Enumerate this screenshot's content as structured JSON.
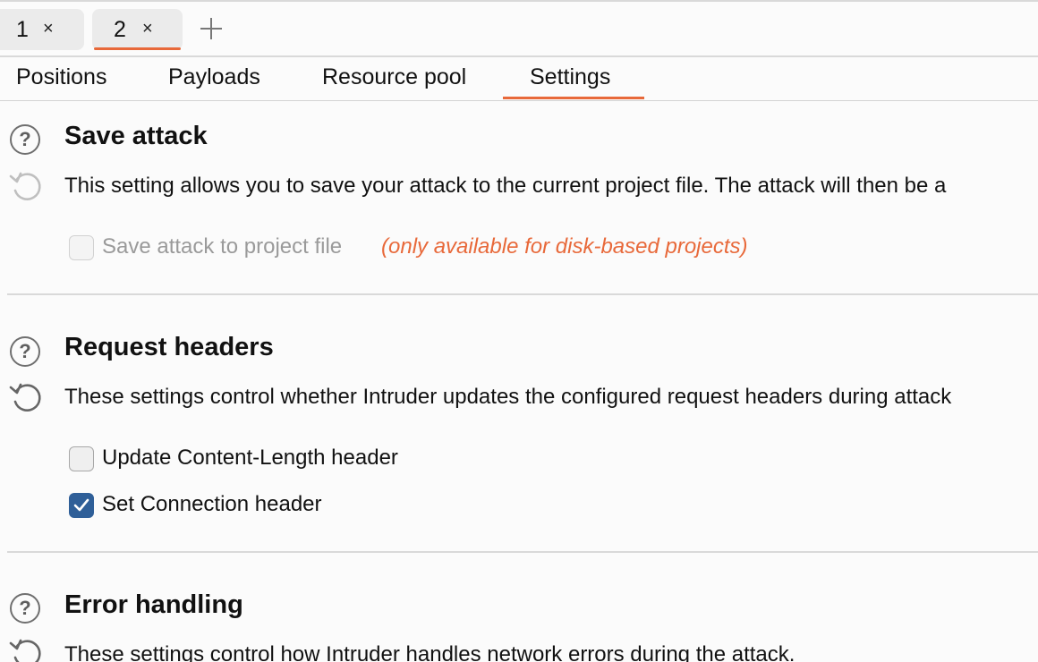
{
  "attack_tabs": [
    {
      "label": "1",
      "close": "×",
      "selected": false
    },
    {
      "label": "2",
      "close": "×",
      "selected": true
    }
  ],
  "sub_tabs": [
    {
      "label": "Positions"
    },
    {
      "label": "Payloads"
    },
    {
      "label": "Resource pool"
    },
    {
      "label": "Settings",
      "selected": true
    }
  ],
  "accent_color": "#e8693a",
  "checkbox_color": "#2f5f98",
  "sections": {
    "save_attack": {
      "title": "Save attack",
      "description": "This setting allows you to save your attack to the current project file. The attack will then be a",
      "option_label": "Save attack to project file",
      "option_checked": false,
      "option_disabled": true,
      "note": "(only available for disk-based projects)"
    },
    "request_headers": {
      "title": "Request headers",
      "description": "These settings control whether Intruder updates the configured request headers during attack",
      "options": [
        {
          "label": "Update Content-Length header",
          "checked": false
        },
        {
          "label": "Set Connection header",
          "checked": true
        }
      ]
    },
    "error_handling": {
      "title": "Error handling",
      "description": "These settings control how Intruder handles network errors during the attack."
    }
  },
  "icons": [
    "close-icon",
    "plus-icon",
    "help-icon",
    "reset-icon",
    "checkmark-icon"
  ]
}
